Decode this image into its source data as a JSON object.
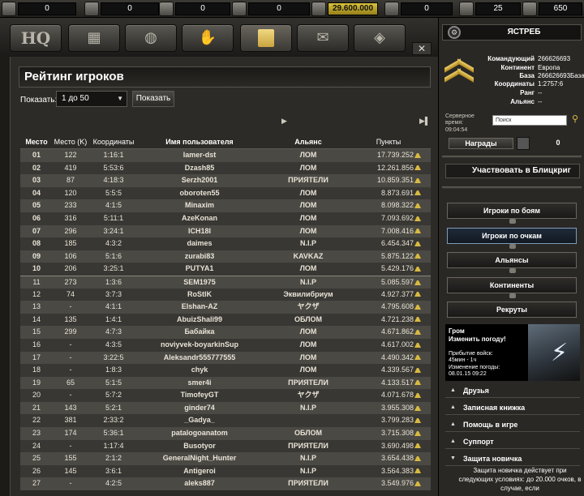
{
  "resources": [
    {
      "name": "Resource 1",
      "icon": "resource-1-icon",
      "value": "0"
    },
    {
      "name": "Resource 2",
      "icon": "resource-2-icon",
      "value": "0"
    },
    {
      "name": "Resource 3",
      "icon": "resource-3-icon",
      "value": "0"
    },
    {
      "name": "Resource 4",
      "icon": "ammo-icon",
      "value": "0"
    },
    {
      "name": "Money",
      "icon": "money-icon",
      "value": "29.600.000"
    },
    {
      "name": "Gold",
      "icon": "gold-icon",
      "value": "0"
    },
    {
      "name": "Diamonds",
      "icon": "diamond-icon",
      "value": "25"
    },
    {
      "name": "Rank points",
      "icon": "rank-icon",
      "value": "650"
    }
  ],
  "nav": {
    "hq_label": "HQ"
  },
  "main": {
    "title": "Рейтинг игроков",
    "show_label": "Показать:",
    "range_value": "1 до 50",
    "show_button": "Показать"
  },
  "table": {
    "headers": [
      "Место",
      "Место (K)",
      "Координаты",
      "Имя пользователя",
      "Альянс",
      "Пункты"
    ],
    "rows": [
      [
        "01",
        "122",
        "1:16:1",
        "lamer-dst",
        "ЛОМ",
        "17.739.252"
      ],
      [
        "02",
        "419",
        "5:53:6",
        "Dzash85",
        "ЛОМ",
        "12.261.856"
      ],
      [
        "03",
        "87",
        "4:18:3",
        "Serzh2001",
        "ПРИЯТЕЛИ",
        "10.859.351"
      ],
      [
        "04",
        "120",
        "5:5:5",
        "oboroten55",
        "ЛОМ",
        "8.873.691"
      ],
      [
        "05",
        "233",
        "4:1:5",
        "Minaxim",
        "ЛОМ",
        "8.098.322"
      ],
      [
        "06",
        "316",
        "5:11:1",
        "AzeKonan",
        "ЛОМ",
        "7.093.692"
      ],
      [
        "07",
        "296",
        "3:24:1",
        "ICH18I",
        "ЛОМ",
        "7.008.416"
      ],
      [
        "08",
        "185",
        "4:3:2",
        "daimes",
        "N.I.P",
        "6.454.347"
      ],
      [
        "09",
        "106",
        "5:1:6",
        "zurabi83",
        "KAVKAZ",
        "5.875.122"
      ],
      [
        "10",
        "206",
        "3:25:1",
        "PUTYA1",
        "ЛОМ",
        "5.429.176"
      ],
      [
        "11",
        "273",
        "1:3:6",
        "SEM1975",
        "N.I.P",
        "5.085.597"
      ],
      [
        "12",
        "74",
        "3:7:3",
        "RoStIK",
        "Эквилибриум",
        "4.927.377"
      ],
      [
        "13",
        "-",
        "4:1:1",
        "Elshan-AZ",
        "ヤクザ",
        "4.795.608"
      ],
      [
        "14",
        "135",
        "1:4:1",
        "AbuizShali99",
        "ОБЛОМ",
        "4.721.238"
      ],
      [
        "15",
        "299",
        "4:7:3",
        "Бабайка",
        "ЛОМ",
        "4.671.862"
      ],
      [
        "16",
        "-",
        "4:3:5",
        "noviyvek-boyarkinSup",
        "ЛОМ",
        "4.617.002"
      ],
      [
        "17",
        "-",
        "3:22:5",
        "Aleksandr555777555",
        "ЛОМ",
        "4.490.342"
      ],
      [
        "18",
        "-",
        "1:8:3",
        "chyk",
        "ЛОМ",
        "4.339.567"
      ],
      [
        "19",
        "65",
        "5:1:5",
        "smer4i",
        "ПРИЯТЕЛИ",
        "4.133.517"
      ],
      [
        "20",
        "-",
        "5:7:2",
        "TimofeyGT",
        "ヤクザ",
        "4.071.678"
      ],
      [
        "21",
        "143",
        "5:2:1",
        "ginder74",
        "N.I.P",
        "3.955.308"
      ],
      [
        "22",
        "381",
        "2:33:2",
        "_Gadya_",
        "",
        "3.799.283"
      ],
      [
        "23",
        "174",
        "5:36:1",
        "patalogoanatom",
        "ОБЛОМ",
        "3.715.308"
      ],
      [
        "24",
        "-",
        "1:17:4",
        "Busotyor",
        "ПРИЯТЕЛИ",
        "3.690.498"
      ],
      [
        "25",
        "155",
        "2:1:2",
        "GeneralNight_Hunter",
        "N.I.P",
        "3.654.438"
      ],
      [
        "26",
        "145",
        "3:6:1",
        "Antigeroi",
        "N.I.P",
        "3.564.383"
      ],
      [
        "27",
        "-",
        "4:2:5",
        "aleks887",
        "ПРИЯТЕЛИ",
        "3.549.976"
      ]
    ]
  },
  "side": {
    "commander_name": "ЯСТРЕБ",
    "info": [
      {
        "label": "Командующий",
        "value": "266626693"
      },
      {
        "label": "Континент",
        "value": "Европа"
      },
      {
        "label": "База",
        "value": "266626693База"
      },
      {
        "label": "Координаты",
        "value": "1:2757:6"
      },
      {
        "label": "Ранг",
        "value": "--"
      },
      {
        "label": "Альянс",
        "value": "--"
      }
    ],
    "server_time_label": "Серверное время:",
    "server_time": "09:04:54",
    "search_placeholder": "Поиск",
    "awards_label": "Награды",
    "awards_count": "0",
    "blitz_label": "Участвовать в Блицкриг",
    "buttons": [
      "Игроки по боям",
      "Игроки по очкам",
      "Альянсы",
      "Континенты",
      "Рекруты"
    ],
    "weather": {
      "title": "Гром",
      "subtitle": "Изменить погоду!",
      "arrival_label": "Прибытие войск:",
      "arrival": "45мин - 1ч",
      "change_label": "Изменение погоды:",
      "change": "08.01.15 09:22"
    },
    "accordion": [
      "Друзья",
      "Записная книжка",
      "Помощь в игре",
      "Суппорт",
      "Защита новичка"
    ],
    "protection_text": "Защита новичка действует при следующих условиях: до 20.000 очков, в случае, если"
  }
}
